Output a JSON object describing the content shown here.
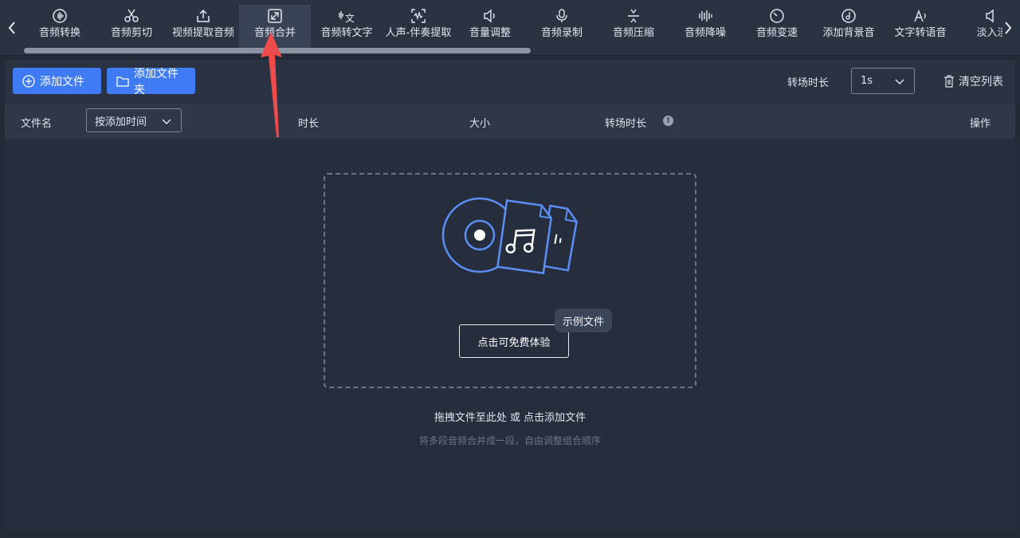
{
  "toolbar": {
    "tools": [
      {
        "label": "音频转换",
        "icon": "audio-convert-icon"
      },
      {
        "label": "音频剪切",
        "icon": "scissors-icon"
      },
      {
        "label": "视频提取音频",
        "icon": "upload-icon"
      },
      {
        "label": "音频合并",
        "icon": "merge-icon",
        "active": true
      },
      {
        "label": "音频转文字",
        "icon": "speech-to-text-icon"
      },
      {
        "label": "人声-伴奏提取",
        "icon": "vocal-extract-icon"
      },
      {
        "label": "音量调整",
        "icon": "volume-icon"
      },
      {
        "label": "音频录制",
        "icon": "microphone-icon"
      },
      {
        "label": "音频压缩",
        "icon": "compress-icon"
      },
      {
        "label": "音频降噪",
        "icon": "noise-reduce-icon"
      },
      {
        "label": "音频变速",
        "icon": "speed-icon"
      },
      {
        "label": "添加背景音",
        "icon": "background-music-icon"
      },
      {
        "label": "文字转语音",
        "icon": "text-to-speech-icon"
      },
      {
        "label": "淡入淡",
        "icon": "fade-icon"
      }
    ]
  },
  "actions": {
    "add_file": "添加文件",
    "add_folder": "添加文件夹",
    "transition_label": "转场时长",
    "transition_value": "1s",
    "clear_list": "清空列表"
  },
  "table": {
    "col_filename": "文件名",
    "sort_value": "按添加时间",
    "col_duration": "时长",
    "col_size": "大小",
    "col_transition": "转场时长",
    "col_info": "!",
    "col_action": "操作"
  },
  "dropzone": {
    "try_button": "点击可免费体验",
    "sample_badge": "示例文件",
    "hint_main": "拖拽文件至此处 或 点击添加文件",
    "hint_sub": "将多段音频合并成一段，自由调整组合顺序"
  },
  "colors": {
    "accent": "#3e7bf5",
    "annotation_arrow": "#ef4b4b",
    "illustration": "#5b8ff7"
  }
}
